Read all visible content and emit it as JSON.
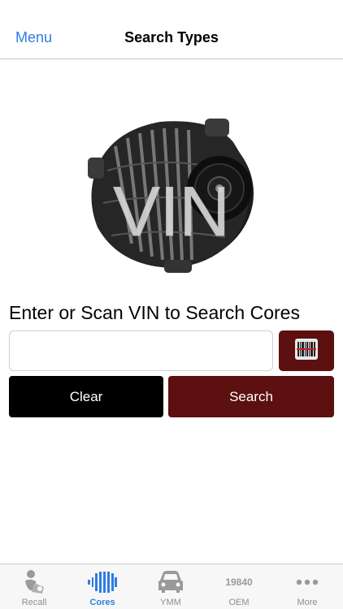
{
  "nav": {
    "back_label": "Menu",
    "title": "Search Types"
  },
  "hero": {
    "overlay_text": "VIN",
    "icon": "alternator-image"
  },
  "prompt": "Enter or Scan VIN to Search Cores",
  "vin_input": {
    "value": "",
    "placeholder": ""
  },
  "buttons": {
    "scan_icon": "barcode-scan-icon",
    "clear": "Clear",
    "search": "Search"
  },
  "tabs": [
    {
      "label": "Recall",
      "icon": "recall-icon",
      "active": false
    },
    {
      "label": "Cores",
      "icon": "cores-icon",
      "active": true
    },
    {
      "label": "YMM",
      "icon": "car-icon",
      "active": false
    },
    {
      "label": "OEM",
      "icon": "oem-number-icon",
      "icon_text": "19840",
      "active": false
    },
    {
      "label": "More",
      "icon": "more-icon",
      "active": false
    }
  ],
  "colors": {
    "accent": "#2f7de1",
    "brand": "#5c1010",
    "clear_button": "#000000"
  }
}
